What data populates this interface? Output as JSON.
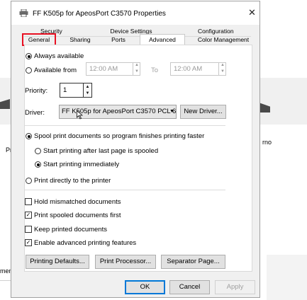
{
  "dialog": {
    "title": "FF K505p for ApeosPort C3570 Properties"
  },
  "tabs": {
    "row1": [
      "Security",
      "Device Settings",
      "Configuration"
    ],
    "row2": [
      "General",
      "Sharing",
      "Ports",
      "Advanced",
      "Color Management"
    ],
    "active": "Advanced",
    "highlighted": "General"
  },
  "availability": {
    "always_label": "Always available",
    "from_label": "Available from",
    "from_time": "12:00 AM",
    "to_label": "To",
    "to_time": "12:00 AM",
    "selected": "Always available"
  },
  "priority": {
    "label": "Priority:",
    "value": "1"
  },
  "driver": {
    "label": "Driver:",
    "selected": "FF K505p for ApeosPort C3570 PCL 6",
    "new_driver_button": "New Driver..."
  },
  "spooling": {
    "spool_label": "Spool print documents so program finishes printing faster",
    "after_last_page_label": "Start printing after last page is spooled",
    "immediately_label": "Start printing immediately",
    "direct_label": "Print directly to the printer",
    "selected": "Spool print documents so program finishes printing faster",
    "start_selected": "Start printing immediately"
  },
  "options": [
    {
      "label": "Hold mismatched documents",
      "checked": false
    },
    {
      "label": "Print spooled documents first",
      "checked": true
    },
    {
      "label": "Keep printed documents",
      "checked": false
    },
    {
      "label": "Enable advanced printing features",
      "checked": true
    }
  ],
  "bottom_buttons": {
    "defaults": "Printing Defaults...",
    "processor": "Print Processor...",
    "separator": "Separator Page..."
  },
  "footer": {
    "ok": "OK",
    "cancel": "Cancel",
    "apply": "Apply"
  },
  "background": {
    "left_text": "Pr",
    "right_text": "rno",
    "bottom_text": "ment"
  },
  "colors": {
    "accent": "#0078d7",
    "highlight_red": "#e81123"
  }
}
